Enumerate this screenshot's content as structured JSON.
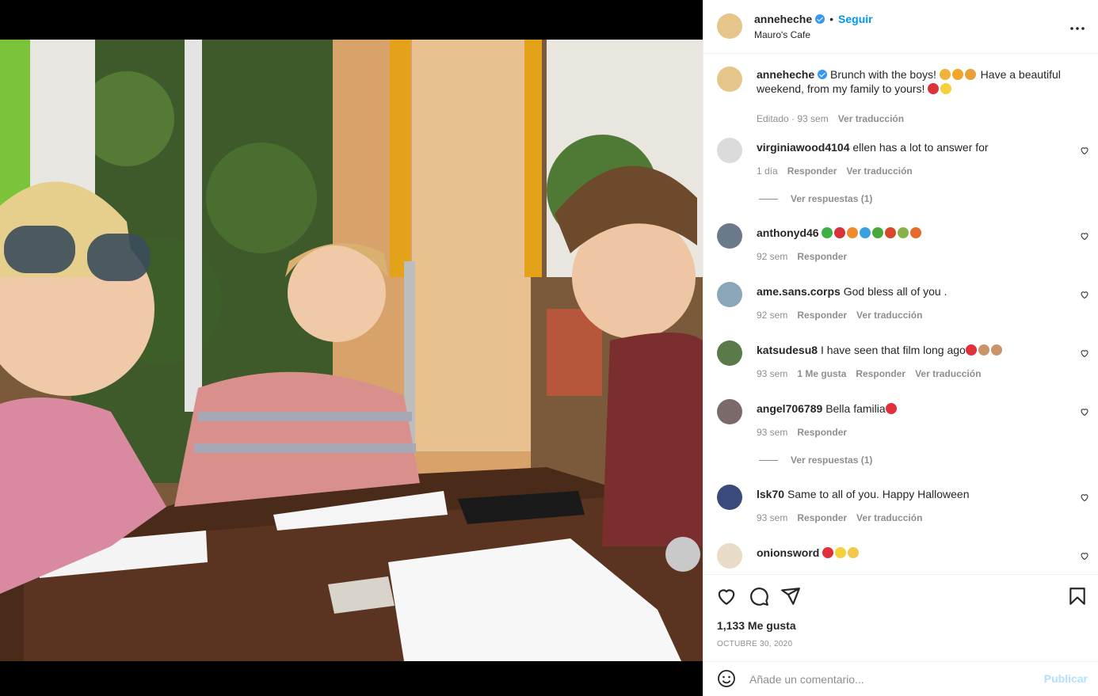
{
  "post": {
    "username": "anneheche",
    "follow_label": "Seguir",
    "location": "Mauro's Cafe",
    "more_label": "•••"
  },
  "caption": {
    "username": "anneheche",
    "text_a": "Brunch with the boys!",
    "text_b": "Have a beautiful weekend, from my family to yours!",
    "edited": "Editado · 93 sem",
    "translate": "Ver traducción"
  },
  "comments": [
    {
      "user": "virginiawood4104",
      "text": "ellen has a lot to answer for",
      "time": "1 día",
      "reply": "Responder",
      "translate": "Ver traducción",
      "replies": "Ver respuestas (1)"
    },
    {
      "user": "anthonyd46",
      "text": "",
      "time": "92 sem",
      "reply": "Responder"
    },
    {
      "user": "ame.sans.corps",
      "text": "God bless all of you .",
      "time": "92 sem",
      "reply": "Responder",
      "translate": "Ver traducción"
    },
    {
      "user": "katsudesu8",
      "text": "I have seen that film long ago",
      "time": "93 sem",
      "likes": "1 Me gusta",
      "reply": "Responder",
      "translate": "Ver traducción"
    },
    {
      "user": "angel706789",
      "text": "Bella familia",
      "time": "93 sem",
      "reply": "Responder",
      "replies": "Ver respuestas (1)"
    },
    {
      "user": "lsk70",
      "text": "Same to all of you. Happy Halloween",
      "time": "93 sem",
      "reply": "Responder",
      "translate": "Ver traducción"
    },
    {
      "user": "onionsword",
      "text": ""
    }
  ],
  "stats": {
    "likes": "1,133 Me gusta",
    "date": "OCTUBRE 30, 2020"
  },
  "composer": {
    "placeholder": "Añade un comentario...",
    "publish": "Publicar"
  },
  "colors": {
    "accent": "#0095f6",
    "muted": "#8e8e8e",
    "verified": "#3897f0"
  }
}
